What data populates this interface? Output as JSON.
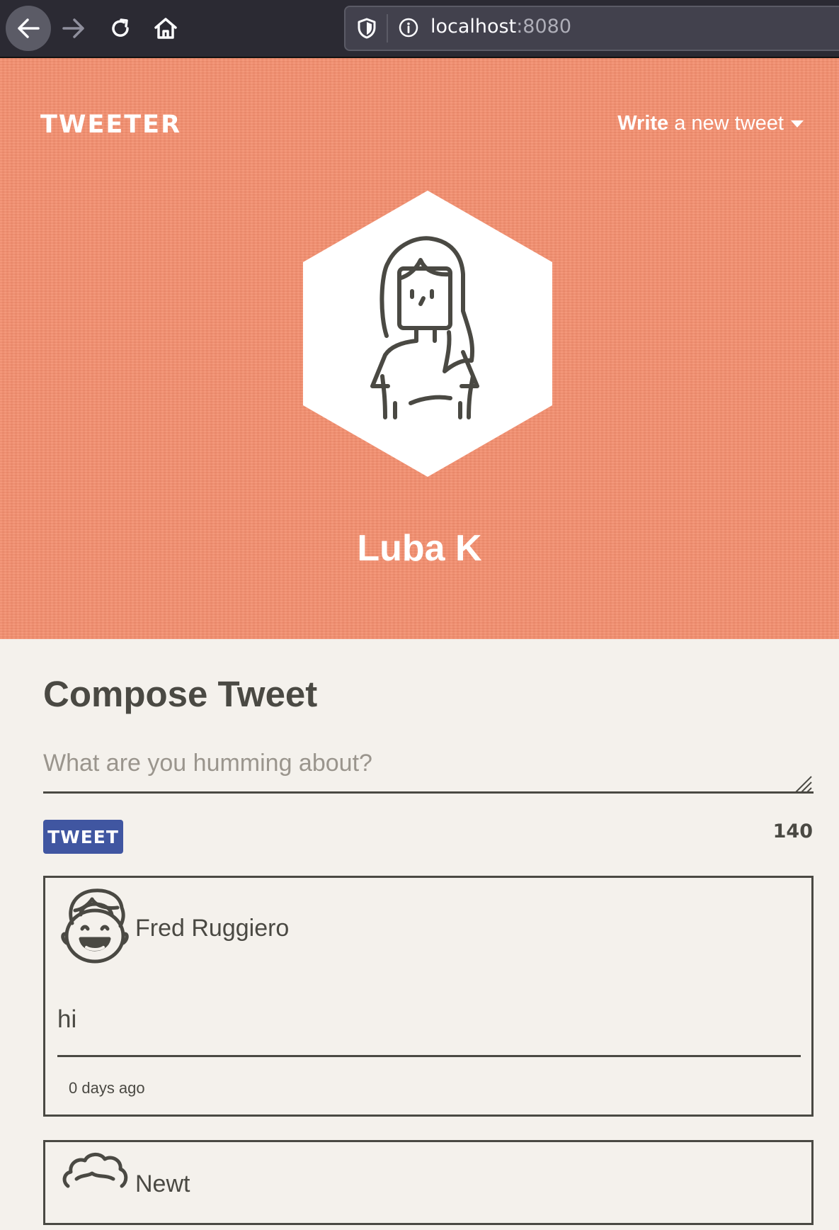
{
  "browser": {
    "url_host": "localhost",
    "url_port": ":8080"
  },
  "header": {
    "logo": "TWEETER",
    "write_bold": "Write",
    "write_rest": " a new tweet",
    "user_name": "Luba K"
  },
  "compose": {
    "title": "Compose Tweet",
    "placeholder": "What are you humming about?",
    "button_label": "TWEET",
    "counter": "140"
  },
  "tweets": [
    {
      "user": "Fred Ruggiero",
      "text": "hi",
      "time": "0 days ago"
    },
    {
      "user": "Newt"
    }
  ],
  "colors": {
    "header_bg": "#f38e6e",
    "page_bg": "#f4f1ec",
    "text": "#4a4943",
    "button": "#4056a1"
  }
}
